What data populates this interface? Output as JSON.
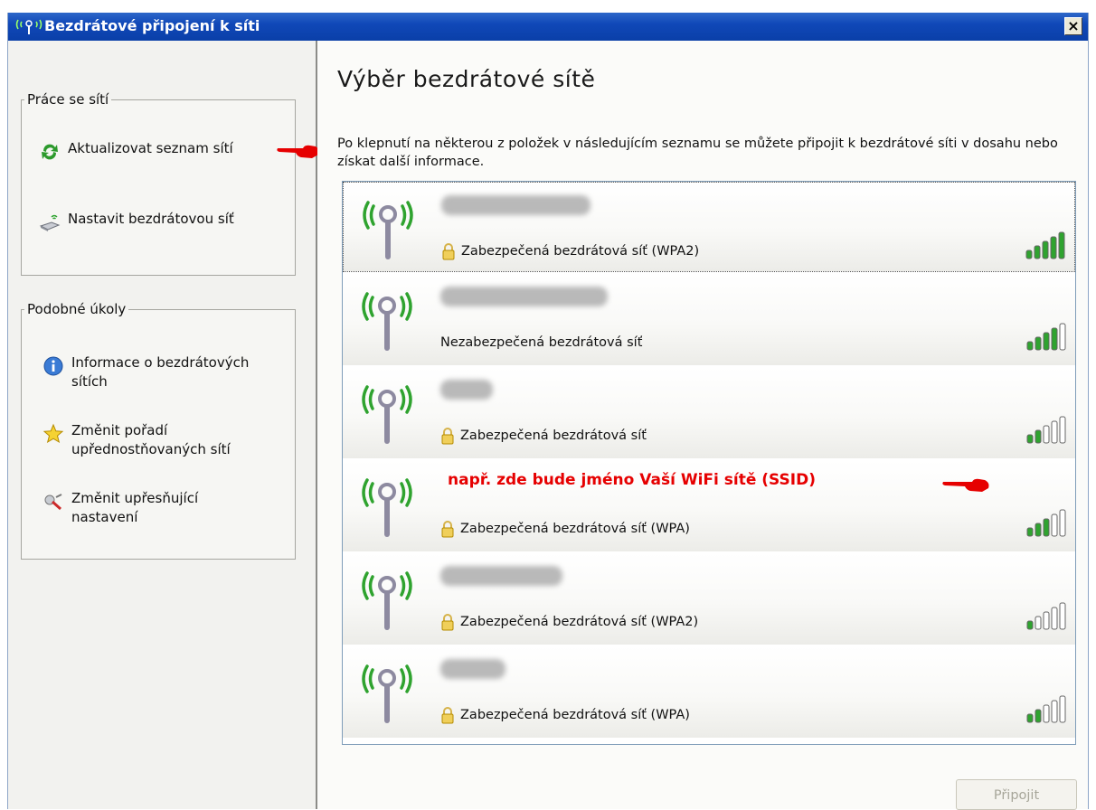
{
  "window": {
    "title": "Bezdrátové připojení k síti",
    "close_symbol": "×"
  },
  "sidebar": {
    "network_tasks": {
      "title": "Práce se sítí",
      "items": [
        {
          "label": "Aktualizovat seznam sítí",
          "icon": "refresh-icon"
        },
        {
          "label": "Nastavit bezdrátovou síť",
          "icon": "setup-wireless-icon"
        }
      ]
    },
    "related_tasks": {
      "title": "Podobné úkoly",
      "items": [
        {
          "label": "Informace o bezdrátových sítích",
          "icon": "info-icon"
        },
        {
          "label": "Změnit pořadí upřednostňovaných sítí",
          "icon": "star-icon"
        },
        {
          "label": "Změnit upřesňující nastavení",
          "icon": "settings-icon"
        }
      ]
    }
  },
  "main": {
    "title": "Výběr bezdrátové sítě",
    "instructions": "Po klepnutí na některou z položek v následujícím seznamu se můžete připojit k bezdrátové síti v dosahu nebo získat další informace.",
    "networks": [
      {
        "security": "Zabezpečená bezdrátová síť (WPA2)",
        "secured": true,
        "signal": 5,
        "selected": true
      },
      {
        "security": "Nezabezpečená bezdrátová síť",
        "secured": false,
        "signal": 4
      },
      {
        "security": "Zabezpečená bezdrátová síť",
        "secured": true,
        "signal": 2
      },
      {
        "annotation": "např. zde bude jméno Vaší WiFi sítě (SSID)",
        "security": "Zabezpečená bezdrátová síť (WPA)",
        "secured": true,
        "signal": 3
      },
      {
        "security": "Zabezpečená bezdrátová síť (WPA2)",
        "secured": true,
        "signal": 1
      },
      {
        "security": "Zabezpečená bezdrátová síť (WPA)",
        "secured": true,
        "signal": 2
      }
    ],
    "connect_label": "Připojit"
  },
  "colors": {
    "titlebar": "#0a3fa8",
    "annotation_red": "#e60000",
    "signal_green": "#2fa32f"
  }
}
